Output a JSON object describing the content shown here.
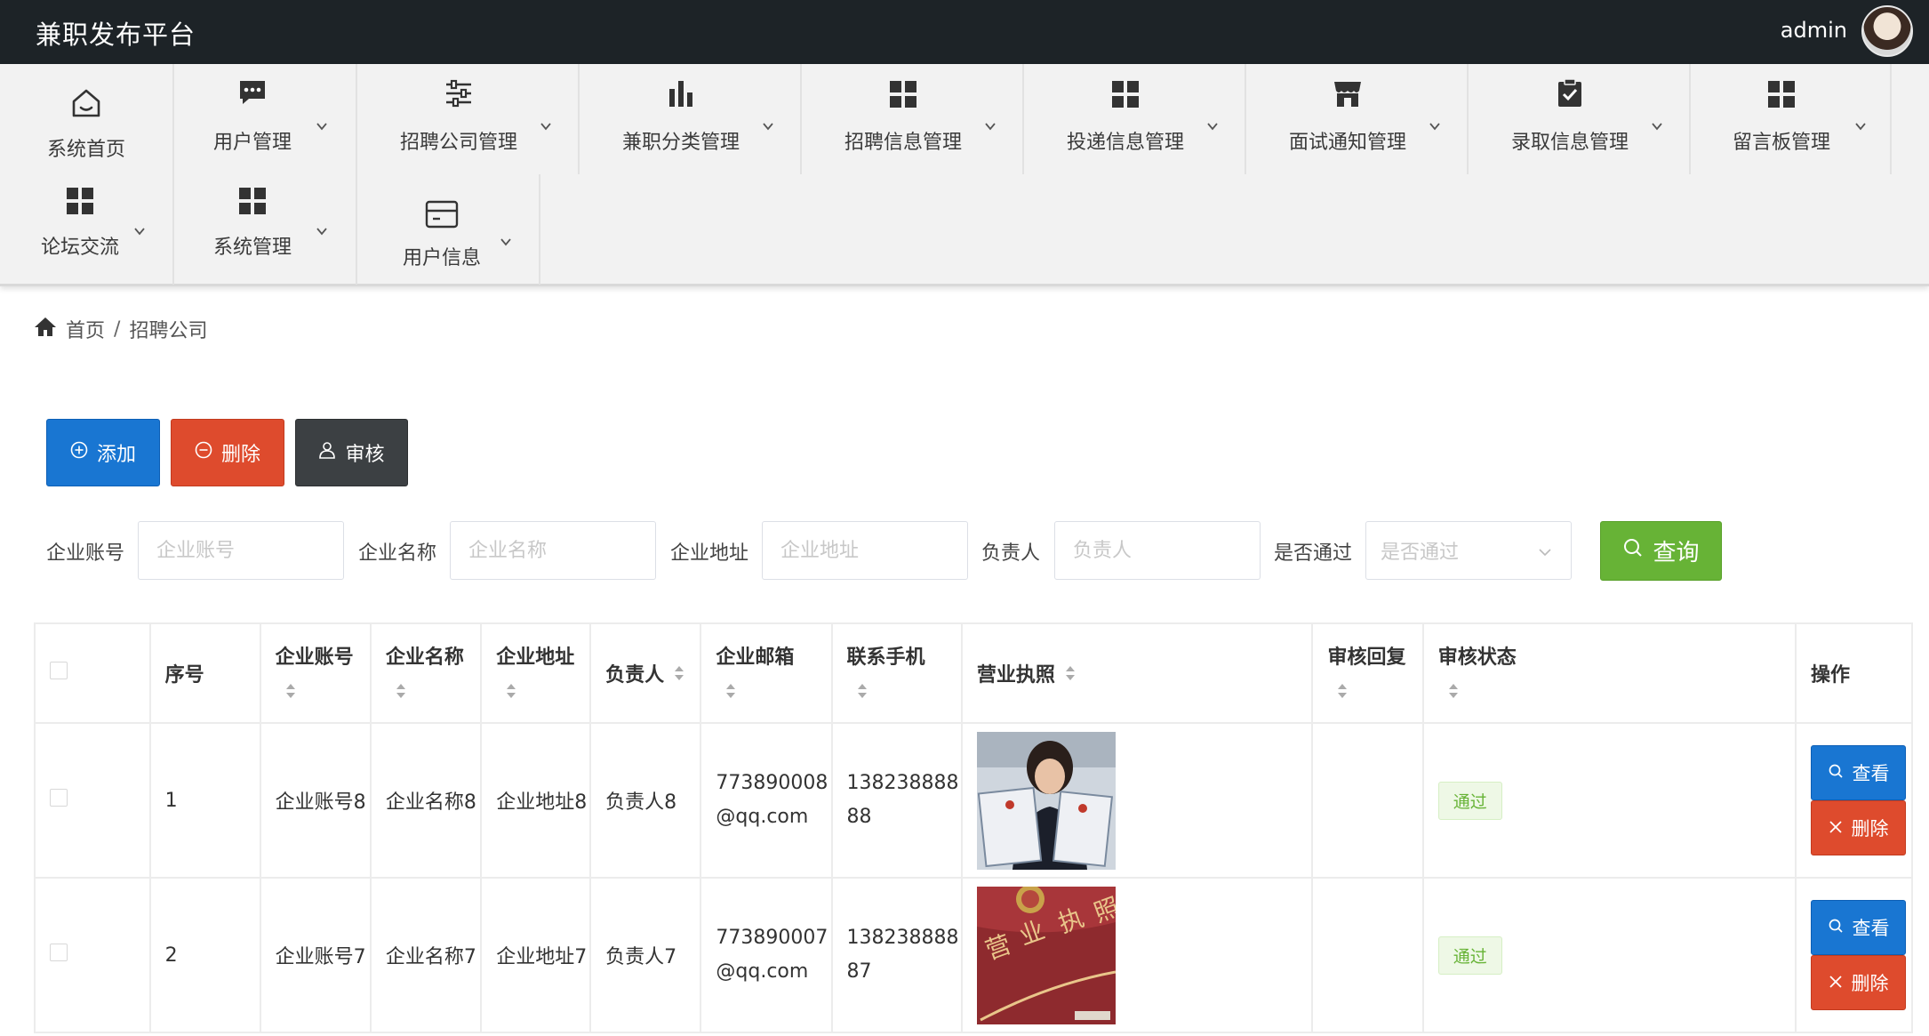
{
  "header": {
    "title": "兼职发布平台",
    "username": "admin"
  },
  "nav": {
    "row1": [
      {
        "label": "系统首页",
        "icon": "home-icon"
      },
      {
        "label": "用户管理",
        "icon": "chat-icon"
      },
      {
        "label": "招聘公司管理",
        "icon": "sliders-icon"
      },
      {
        "label": "兼职分类管理",
        "icon": "bar-chart-icon"
      },
      {
        "label": "招聘信息管理",
        "icon": "grid-icon"
      },
      {
        "label": "投递信息管理",
        "icon": "grid-icon"
      },
      {
        "label": "面试通知管理",
        "icon": "store-icon"
      },
      {
        "label": "录取信息管理",
        "icon": "clipboard-check-icon"
      },
      {
        "label": "留言板管理",
        "icon": "grid-icon"
      }
    ],
    "row2": [
      {
        "label": "论坛交流",
        "icon": "grid-icon"
      },
      {
        "label": "系统管理",
        "icon": "grid-icon"
      },
      {
        "label": "用户信息",
        "icon": "card-icon"
      }
    ]
  },
  "breadcrumb": {
    "home": "首页",
    "sep": "/",
    "current": "招聘公司"
  },
  "toolbar": {
    "add": "添加",
    "delete": "删除",
    "audit": "审核"
  },
  "search": {
    "fields": [
      {
        "label": "企业账号",
        "placeholder": "企业账号"
      },
      {
        "label": "企业名称",
        "placeholder": "企业名称"
      },
      {
        "label": "企业地址",
        "placeholder": "企业地址"
      },
      {
        "label": "负责人",
        "placeholder": "负责人"
      }
    ],
    "select_label": "是否通过",
    "select_placeholder": "是否通过",
    "query": "查询"
  },
  "table": {
    "headers": {
      "index": "序号",
      "account": "企业账号",
      "name": "企业名称",
      "address": "企业地址",
      "owner": "负责人",
      "email": "企业邮箱",
      "phone": "联系手机",
      "license": "营业执照",
      "reply": "审核回复",
      "status": "审核状态",
      "ops": "操作"
    },
    "rows": [
      {
        "index": "1",
        "account": "企业账号8",
        "name": "企业名称8",
        "address": "企业地址8",
        "owner": "负责人8",
        "email_l1": "773890008",
        "email_l2": "@qq.com",
        "phone_l1": "138238888",
        "phone_l2": "88",
        "reply": "",
        "status": "通过"
      },
      {
        "index": "2",
        "account": "企业账号7",
        "name": "企业名称7",
        "address": "企业地址7",
        "owner": "负责人7",
        "email_l1": "773890007",
        "email_l2": "@qq.com",
        "phone_l1": "138238888",
        "phone_l2": "87",
        "reply": "",
        "status": "通过"
      }
    ],
    "view_label": "查看",
    "delete_label": "删除"
  },
  "colors": {
    "header_bg": "#1d2327",
    "primary": "#1976d2",
    "danger": "#de4b2d",
    "dark": "#3c4043",
    "success": "#67b336"
  }
}
